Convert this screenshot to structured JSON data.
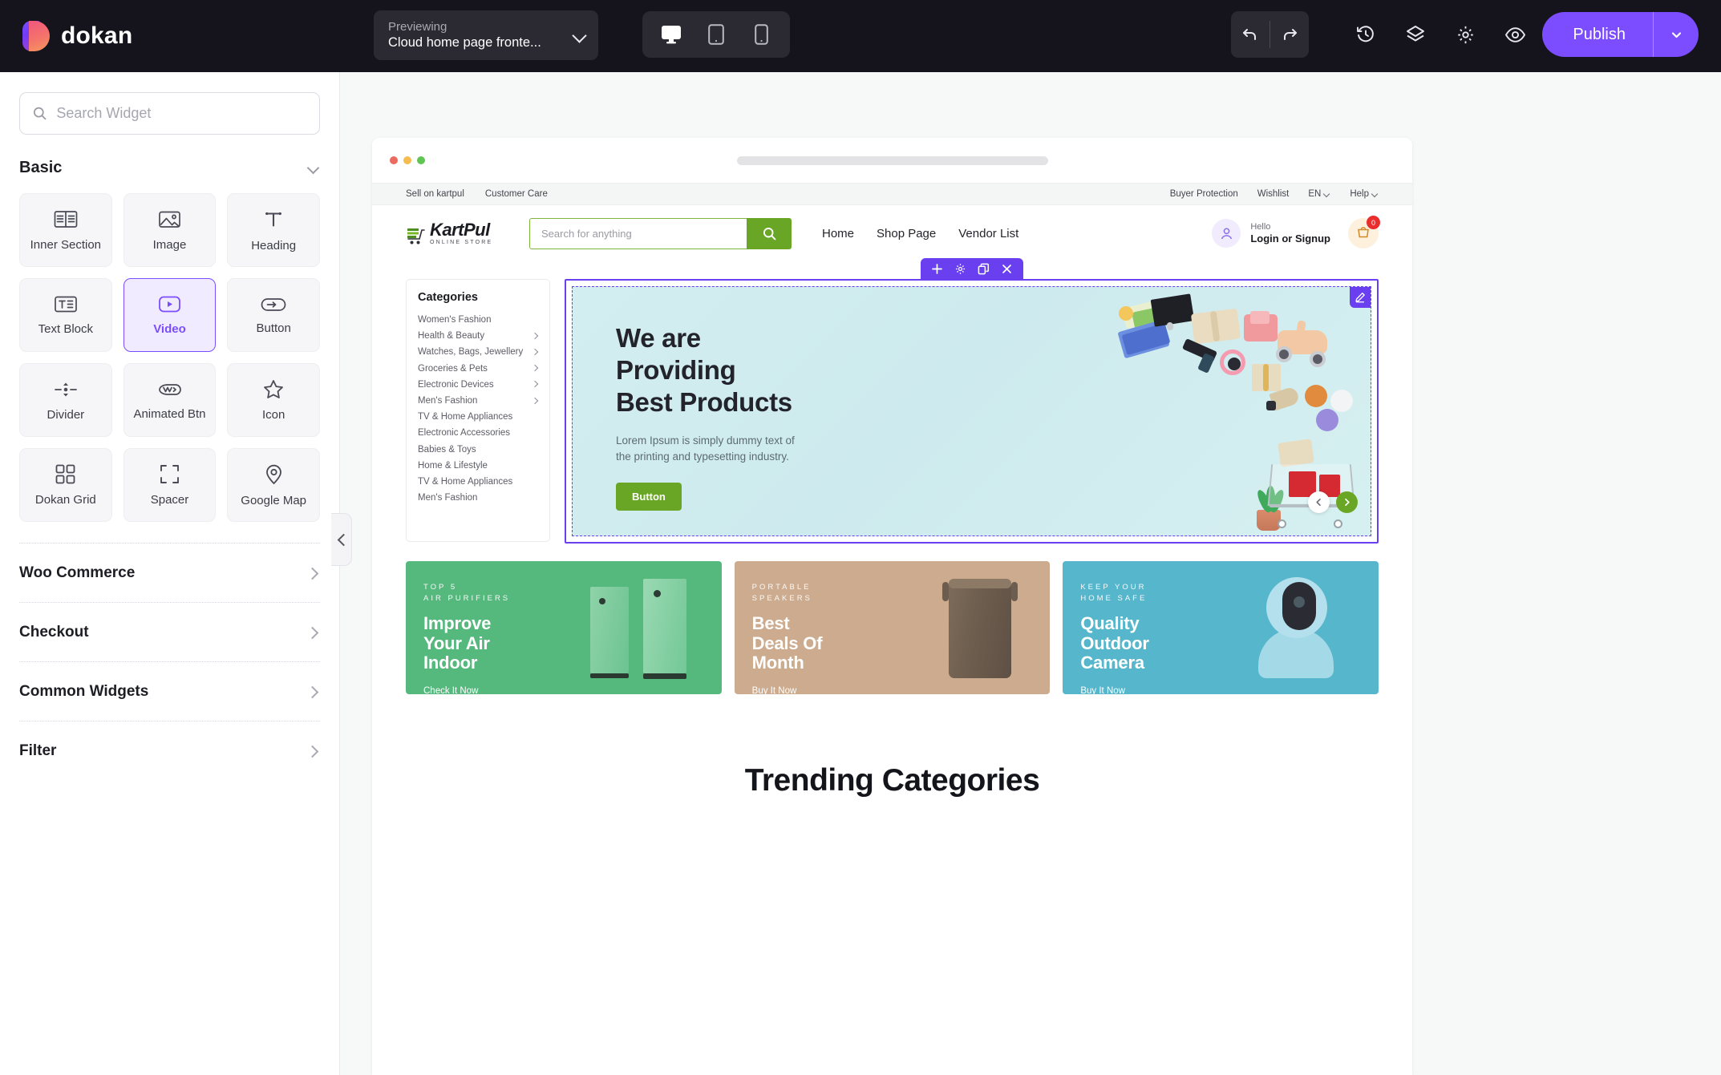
{
  "app": {
    "brand_name": "dokan",
    "accent_purple": "#7c4dff",
    "topbar_bg": "#15141d"
  },
  "topbar": {
    "preview": {
      "label": "Previewing",
      "value": "Cloud home page fronte..."
    },
    "devices": [
      {
        "name": "desktop-view",
        "active": true
      },
      {
        "name": "tablet-view",
        "active": false
      },
      {
        "name": "mobile-view",
        "active": false
      }
    ],
    "tools": [
      {
        "name": "undo",
        "icon": "undo-icon"
      },
      {
        "name": "redo",
        "icon": "redo-icon"
      },
      {
        "name": "history",
        "icon": "history-icon"
      },
      {
        "name": "layers",
        "icon": "layers-icon"
      },
      {
        "name": "settings",
        "icon": "gear-icon"
      },
      {
        "name": "preview",
        "icon": "eye-icon"
      }
    ],
    "publish_label": "Publish"
  },
  "sidebar": {
    "search_placeholder": "Search Widget",
    "search_value": "",
    "basic_section": "Basic",
    "widgets": [
      {
        "label": "Inner Section",
        "icon": "inner-section-icon",
        "selected": false
      },
      {
        "label": "Image",
        "icon": "image-icon",
        "selected": false
      },
      {
        "label": "Heading",
        "icon": "heading-icon",
        "selected": false
      },
      {
        "label": "Text Block",
        "icon": "text-block-icon",
        "selected": false
      },
      {
        "label": "Video",
        "icon": "video-icon",
        "selected": true
      },
      {
        "label": "Button",
        "icon": "button-icon",
        "selected": false
      },
      {
        "label": "Divider",
        "icon": "divider-icon",
        "selected": false
      },
      {
        "label": "Animated Btn",
        "icon": "animated-btn-icon",
        "selected": false
      },
      {
        "label": "Icon",
        "icon": "star-icon",
        "selected": false
      },
      {
        "label": "Dokan Grid",
        "icon": "grid-icon",
        "selected": false
      },
      {
        "label": "Spacer",
        "icon": "spacer-icon",
        "selected": false
      },
      {
        "label": "Google Map",
        "icon": "map-pin-icon",
        "selected": false
      }
    ],
    "groups": [
      {
        "label": "Woo Commerce"
      },
      {
        "label": "Checkout"
      },
      {
        "label": "Common Widgets"
      },
      {
        "label": "Filter"
      }
    ]
  },
  "canvas": {
    "element_toolbar": [
      {
        "name": "add-element",
        "icon": "plus-icon"
      },
      {
        "name": "element-settings",
        "icon": "gear-icon"
      },
      {
        "name": "duplicate-element",
        "icon": "duplicate-icon"
      },
      {
        "name": "delete-element",
        "icon": "close-icon"
      }
    ],
    "browser_dots": [
      "#ed6a5e",
      "#f5bd4f",
      "#61c554"
    ]
  },
  "site": {
    "utility_left": [
      "Sell on kartpul",
      "Customer Care"
    ],
    "utility_right": [
      "Buyer Protection",
      "Wishlist",
      "EN",
      "Help"
    ],
    "logo": {
      "name": "KartPul",
      "tagline": "ONLINE STORE"
    },
    "search_placeholder": "Search for anything",
    "search_value": "",
    "nav": [
      "Home",
      "Shop Page",
      "Vendor List"
    ],
    "account": {
      "greeting": "Hello",
      "action": "Login or Signup"
    },
    "cart_count": "0",
    "categories": {
      "title": "Categories",
      "items": [
        {
          "label": "Women's Fashion",
          "has_children": false
        },
        {
          "label": "Health & Beauty",
          "has_children": true
        },
        {
          "label": "Watches, Bags, Jewellery",
          "has_children": true
        },
        {
          "label": "Groceries & Pets",
          "has_children": true
        },
        {
          "label": "Electronic Devices",
          "has_children": true
        },
        {
          "label": "Men's Fashion",
          "has_children": true
        },
        {
          "label": "TV & Home Appliances",
          "has_children": false
        },
        {
          "label": "Electronic Accessories",
          "has_children": false
        },
        {
          "label": "Babies & Toys",
          "has_children": false
        },
        {
          "label": "Home & Lifestyle",
          "has_children": false
        },
        {
          "label": "TV & Home Appliances",
          "has_children": false
        },
        {
          "label": "Men's Fashion",
          "has_children": false
        }
      ]
    },
    "hero": {
      "heading_line1": "We are",
      "heading_line2": "Providing",
      "heading_line3": "Best Products",
      "paragraph_line1": "Lorem Ipsum is simply dummy text of",
      "paragraph_line2": "the printing and typesetting industry.",
      "button_label": "Button",
      "bg_color": "#d3eef0"
    },
    "promos": [
      {
        "kicker_line1": "TOP 5",
        "kicker_line2": "AIR PURIFIERS",
        "title_line1": "Improve",
        "title_line2": "Your Air",
        "title_line3": "Indoor",
        "cta": "Check It Now",
        "bg": "#55b97e"
      },
      {
        "kicker_line1": "PORTABLE",
        "kicker_line2": "SPEAKERS",
        "title_line1": "Best",
        "title_line2": "Deals Of",
        "title_line3": "Month",
        "cta": "Buy It Now",
        "bg": "#ccab8e"
      },
      {
        "kicker_line1": "KEEP YOUR",
        "kicker_line2": "HOME SAFE",
        "title_line1": "Quality",
        "title_line2": "Outdoor",
        "title_line3": "Camera",
        "cta": "Buy It Now",
        "bg": "#55b6cc"
      }
    ],
    "trending_title": "Trending Categories"
  }
}
